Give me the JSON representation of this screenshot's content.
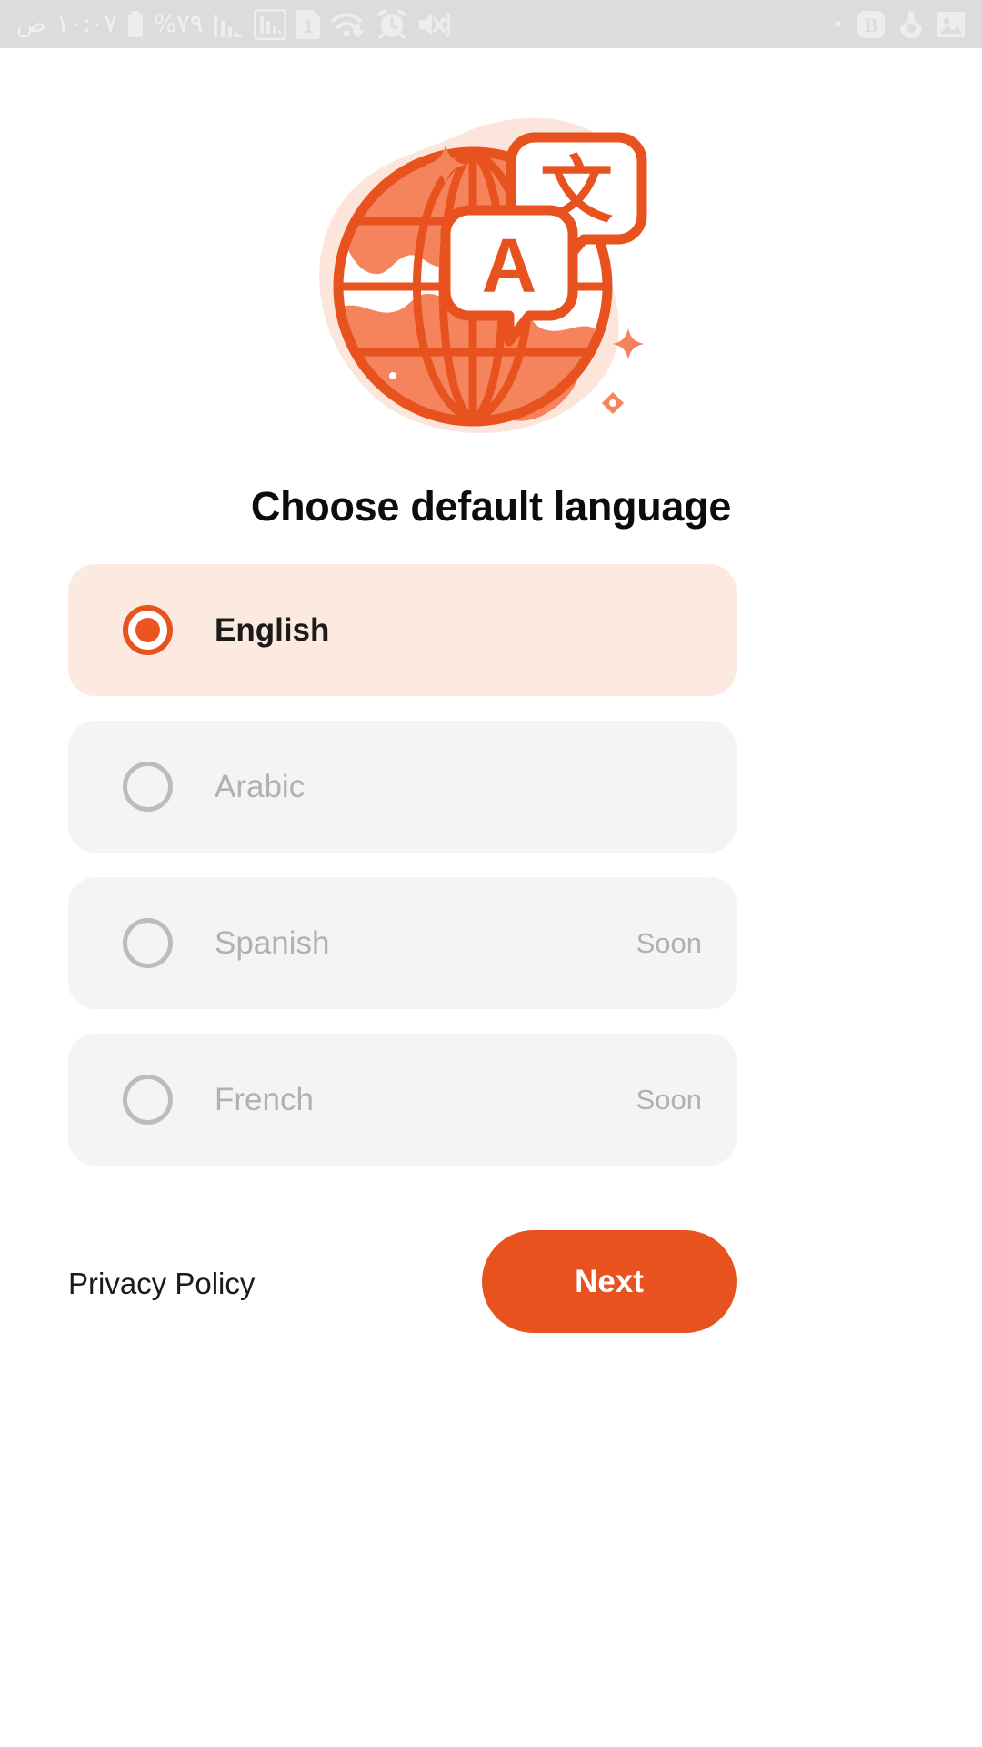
{
  "status_bar": {
    "am_pm": "ص",
    "time": "١٠:٠٧",
    "battery_percent": "%٧٩",
    "sim_label": "1",
    "icons_left": [
      "battery-icon",
      "signal-bars-icon",
      "signal-bars-boxed-icon",
      "sim-card-icon",
      "wifi-download-icon",
      "alarm-clock-icon",
      "volume-mute-vibrate-icon"
    ],
    "icons_right": [
      "small-dot-icon",
      "bold-app-icon",
      "location-person-icon",
      "image-gallery-icon"
    ],
    "background_color": "#dcdcdc",
    "foreground_color": "#ededed"
  },
  "illustration": {
    "name": "language-translate-globe-illustration",
    "latin_letter": "A",
    "cjk_letter": "文",
    "colors": {
      "blob": "#fce5da",
      "globe_fill": "#f5845d",
      "stroke": "#e8521f"
    }
  },
  "header": {
    "title": "Choose default language"
  },
  "languages": [
    {
      "label": "English",
      "badge": "",
      "selected": true,
      "disabled": false
    },
    {
      "label": "Arabic",
      "badge": "",
      "selected": false,
      "disabled": true
    },
    {
      "label": "Spanish",
      "badge": "Soon",
      "selected": false,
      "disabled": true
    },
    {
      "label": "French",
      "badge": "Soon",
      "selected": false,
      "disabled": true
    }
  ],
  "footer": {
    "privacy_policy_label": "Privacy Policy",
    "next_label": "Next"
  },
  "theme": {
    "accent": "#e8521f",
    "accent_light": "#fceae0",
    "disabled_bg": "#f4f4f4",
    "disabled_text": "#b1b1b1",
    "title_text": "#0c0c0c"
  }
}
